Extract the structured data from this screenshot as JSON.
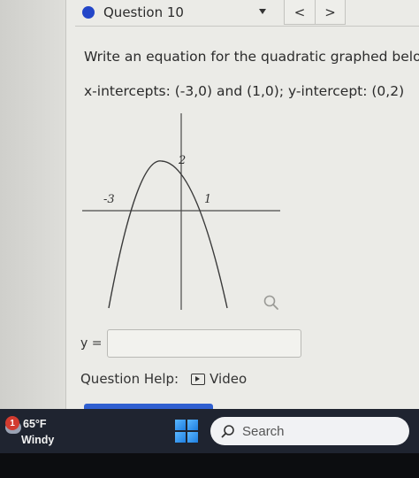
{
  "question": {
    "title": "Question 10",
    "prev_symbol": "<",
    "next_symbol": ">",
    "prompt": "Write an equation for the quadratic graphed below:",
    "intercepts": "x-intercepts: (-3,0) and (1,0); y-intercept: (0,2)"
  },
  "graph": {
    "label_left": "-3",
    "label_right": "1",
    "label_top": "2"
  },
  "answer": {
    "label": "y =",
    "value": ""
  },
  "help": {
    "label": "Question Help:",
    "video_label": "Video"
  },
  "taskbar": {
    "alert_count": "1",
    "temperature": "65°F",
    "condition": "Windy",
    "search_placeholder": "Search"
  },
  "colors": {
    "accent": "#2346c8",
    "page_background": "#ebebe7",
    "taskbar": "#1f2430"
  }
}
